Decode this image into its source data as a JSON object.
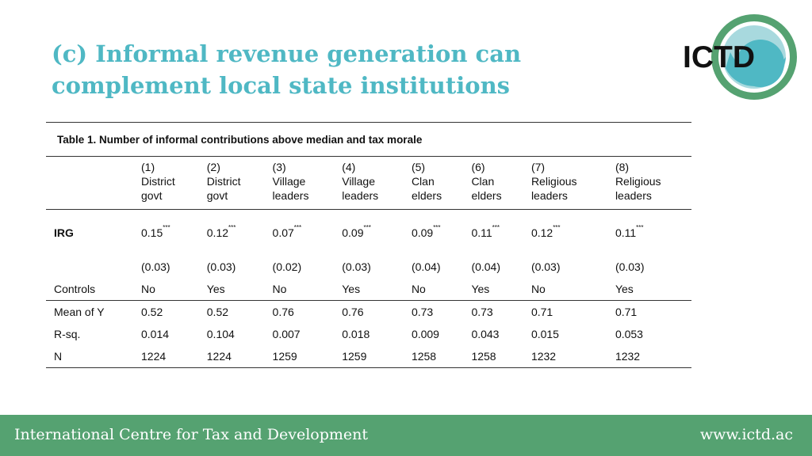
{
  "slide": {
    "title_line1": "(c) Informal revenue generation can",
    "title_line2": "complement local state institutions"
  },
  "logo": {
    "text": "ICTD",
    "colors": {
      "outer": "#55a271",
      "inner": "#4fb8c4"
    }
  },
  "table": {
    "caption": "Table 1. Number of informal contributions above median and tax morale",
    "columns": [
      {
        "num": "(1)",
        "l1": "District",
        "l2": "govt"
      },
      {
        "num": "(2)",
        "l1": "District",
        "l2": "govt"
      },
      {
        "num": "(3)",
        "l1": "Village",
        "l2": "leaders"
      },
      {
        "num": "(4)",
        "l1": "Village",
        "l2": "leaders"
      },
      {
        "num": "(5)",
        "l1": "Clan",
        "l2": "elders"
      },
      {
        "num": "(6)",
        "l1": "Clan",
        "l2": "elders"
      },
      {
        "num": "(7)",
        "l1": "Religious",
        "l2": "leaders"
      },
      {
        "num": "(8)",
        "l1": "Religious",
        "l2": "leaders"
      }
    ],
    "irg": {
      "label": "IRG",
      "values": [
        "0.15",
        "0.12",
        "0.07",
        "0.09",
        "0.09",
        "0.11",
        "0.12",
        "0.11"
      ],
      "stars": "***",
      "se": [
        "(0.03)",
        "(0.03)",
        "(0.02)",
        "(0.03)",
        "(0.04)",
        "(0.04)",
        "(0.03)",
        "(0.03)"
      ]
    },
    "controls": {
      "label": "Controls",
      "values": [
        "No",
        "Yes",
        "No",
        "Yes",
        "No",
        "Yes",
        "No",
        "Yes"
      ]
    },
    "mean_y": {
      "label": "Mean of Y",
      "values": [
        "0.52",
        "0.52",
        "0.76",
        "0.76",
        "0.73",
        "0.73",
        "0.71",
        "0.71"
      ]
    },
    "rsq": {
      "label": "R-sq.",
      "values": [
        "0.014",
        "0.104",
        "0.007",
        "0.018",
        "0.009",
        "0.043",
        "0.015",
        "0.053"
      ]
    },
    "n": {
      "label": "N",
      "values": [
        "1224",
        "1224",
        "1259",
        "1259",
        "1258",
        "1258",
        "1232",
        "1232"
      ]
    }
  },
  "footer": {
    "org": "International Centre for Tax and Development",
    "url": "www.ictd.ac",
    "color": "#55a271"
  }
}
